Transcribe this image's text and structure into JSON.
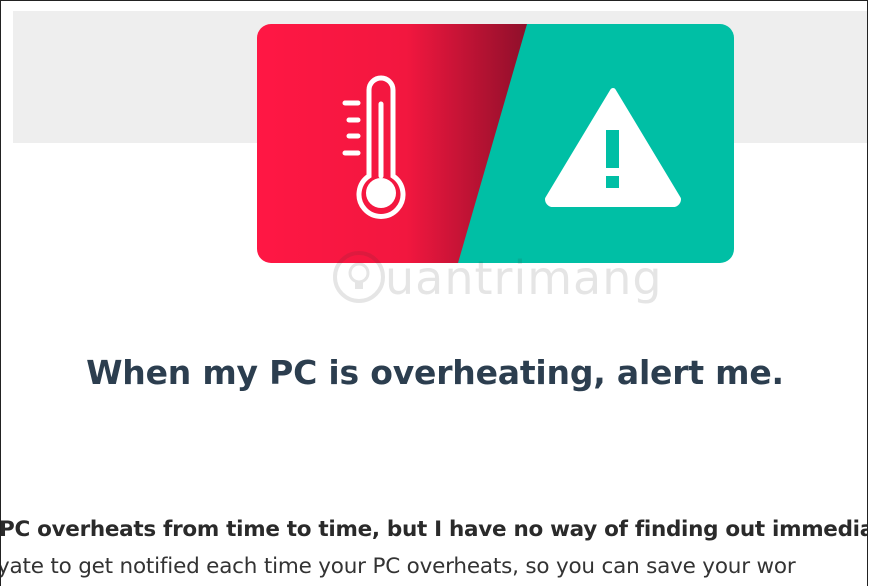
{
  "hero": {
    "left_icon": "thermometer-icon",
    "right_icon": "warning-icon",
    "colors": {
      "left_panel": "#ff1744",
      "right_panel": "#00bfa5",
      "icon": "#ffffff"
    }
  },
  "watermark": {
    "text": "uantrimang",
    "icon": "lightbulb-icon"
  },
  "headline": {
    "text": "When my PC is overheating, alert me.",
    "color": "#2c3e4f"
  },
  "body": {
    "line1": "PC overheats from time to time, but I have no way of finding out immediat",
    "line2": "yate to get notified each time your PC overheats, so you can save your wor"
  }
}
